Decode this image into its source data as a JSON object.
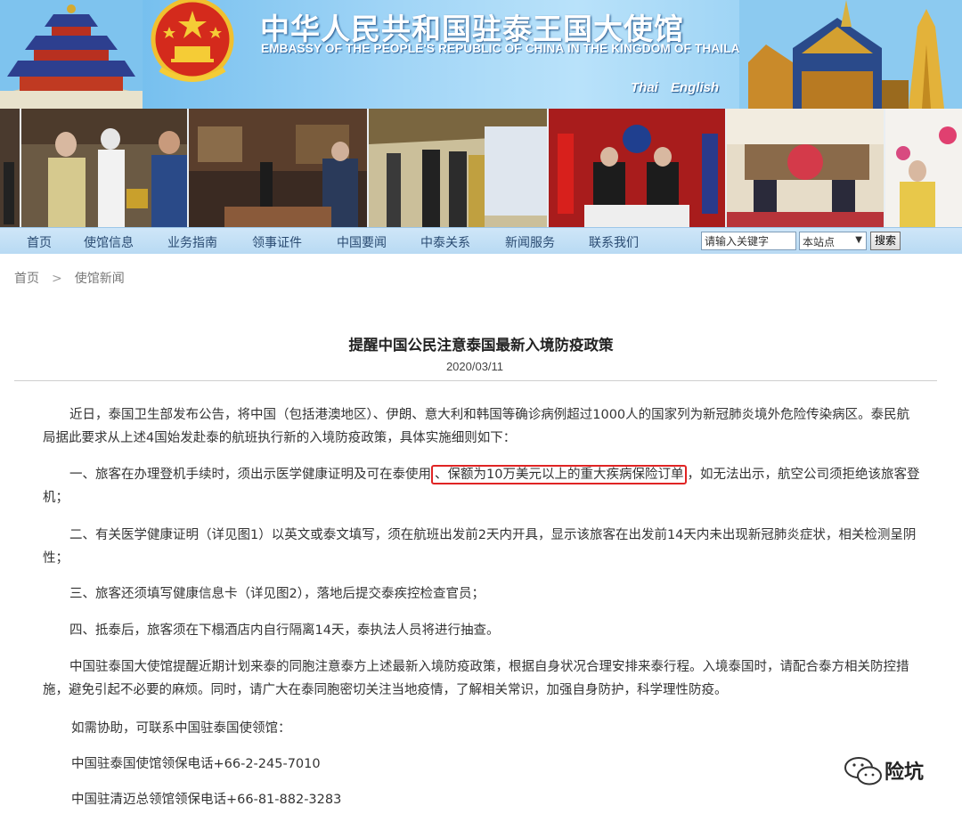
{
  "header": {
    "title_cn": "中华人民共和国驻泰王国大使馆",
    "title_en": "EMBASSY OF THE PEOPLE'S REPUBLIC OF CHINA IN THE KINGDOM OF THAILAND",
    "lang_links": [
      "Thai",
      "English"
    ]
  },
  "nav": {
    "items": [
      "首页",
      "使馆信息",
      "业务指南",
      "领事证件",
      "中国要闻",
      "中泰关系",
      "新闻服务",
      "联系我们"
    ],
    "search_placeholder": "请输入关键字",
    "search_scope": "本站点",
    "search_button": "搜索"
  },
  "breadcrumb": [
    "首页",
    "使馆新闻"
  ],
  "breadcrumb_sep": ">",
  "article": {
    "title": "提醒中国公民注意泰国最新入境防疫政策",
    "date": "2020/03/11",
    "intro": "近日，泰国卫生部发布公告，将中国（包括港澳地区）、伊朗、意大利和韩国等确诊病例超过1000人的国家列为新冠肺炎境外危险传染病区。泰民航局据此要求从上述4国始发赴泰的航班执行新的入境防疫政策，具体实施细则如下：",
    "item1_before": "一、旅客在办理登机手续时，须出示医学健康证明及可在泰使用",
    "item1_highlight": "、保额为10万美元以上的重大疾病保险订单",
    "item1_after": "，如无法出示，航空公司须拒绝该旅客登机；",
    "item2": "二、有关医学健康证明（详见图1）以英文或泰文填写，须在航班出发前2天内开具，显示该旅客在出发前14天内未出现新冠肺炎症状，相关检测呈阴性；",
    "item3": "三、旅客还须填写健康信息卡（详见图2），落地后提交泰疾控检查官员；",
    "item4": "四、抵泰后，旅客须在下榻酒店内自行隔离14天，泰执法人员将进行抽查。",
    "reminder": "中国驻泰国大使馆提醒近期计划来泰的同胞注意泰方上述最新入境防疫政策，根据自身状况合理安排来泰行程。入境泰国时，请配合泰方相关防控措施，避免引起不必要的麻烦。同时，请广大在泰同胞密切关注当地疫情，了解相关常识，加强自身防护，科学理性防疫。",
    "assist": "如需协助，可联系中国驻泰国使领馆：",
    "contact1": "中国驻泰国使馆领保电话+66-2-245-7010",
    "contact2": "中国驻清迈总领馆领保电话+66-81-882-3283"
  },
  "watermark": {
    "text": "险坑",
    "icon": "wechat-icon"
  },
  "colors": {
    "banner_blue": "#5fb4ea",
    "nav_bg": "#c3dff5",
    "highlight_red": "#e02424"
  }
}
